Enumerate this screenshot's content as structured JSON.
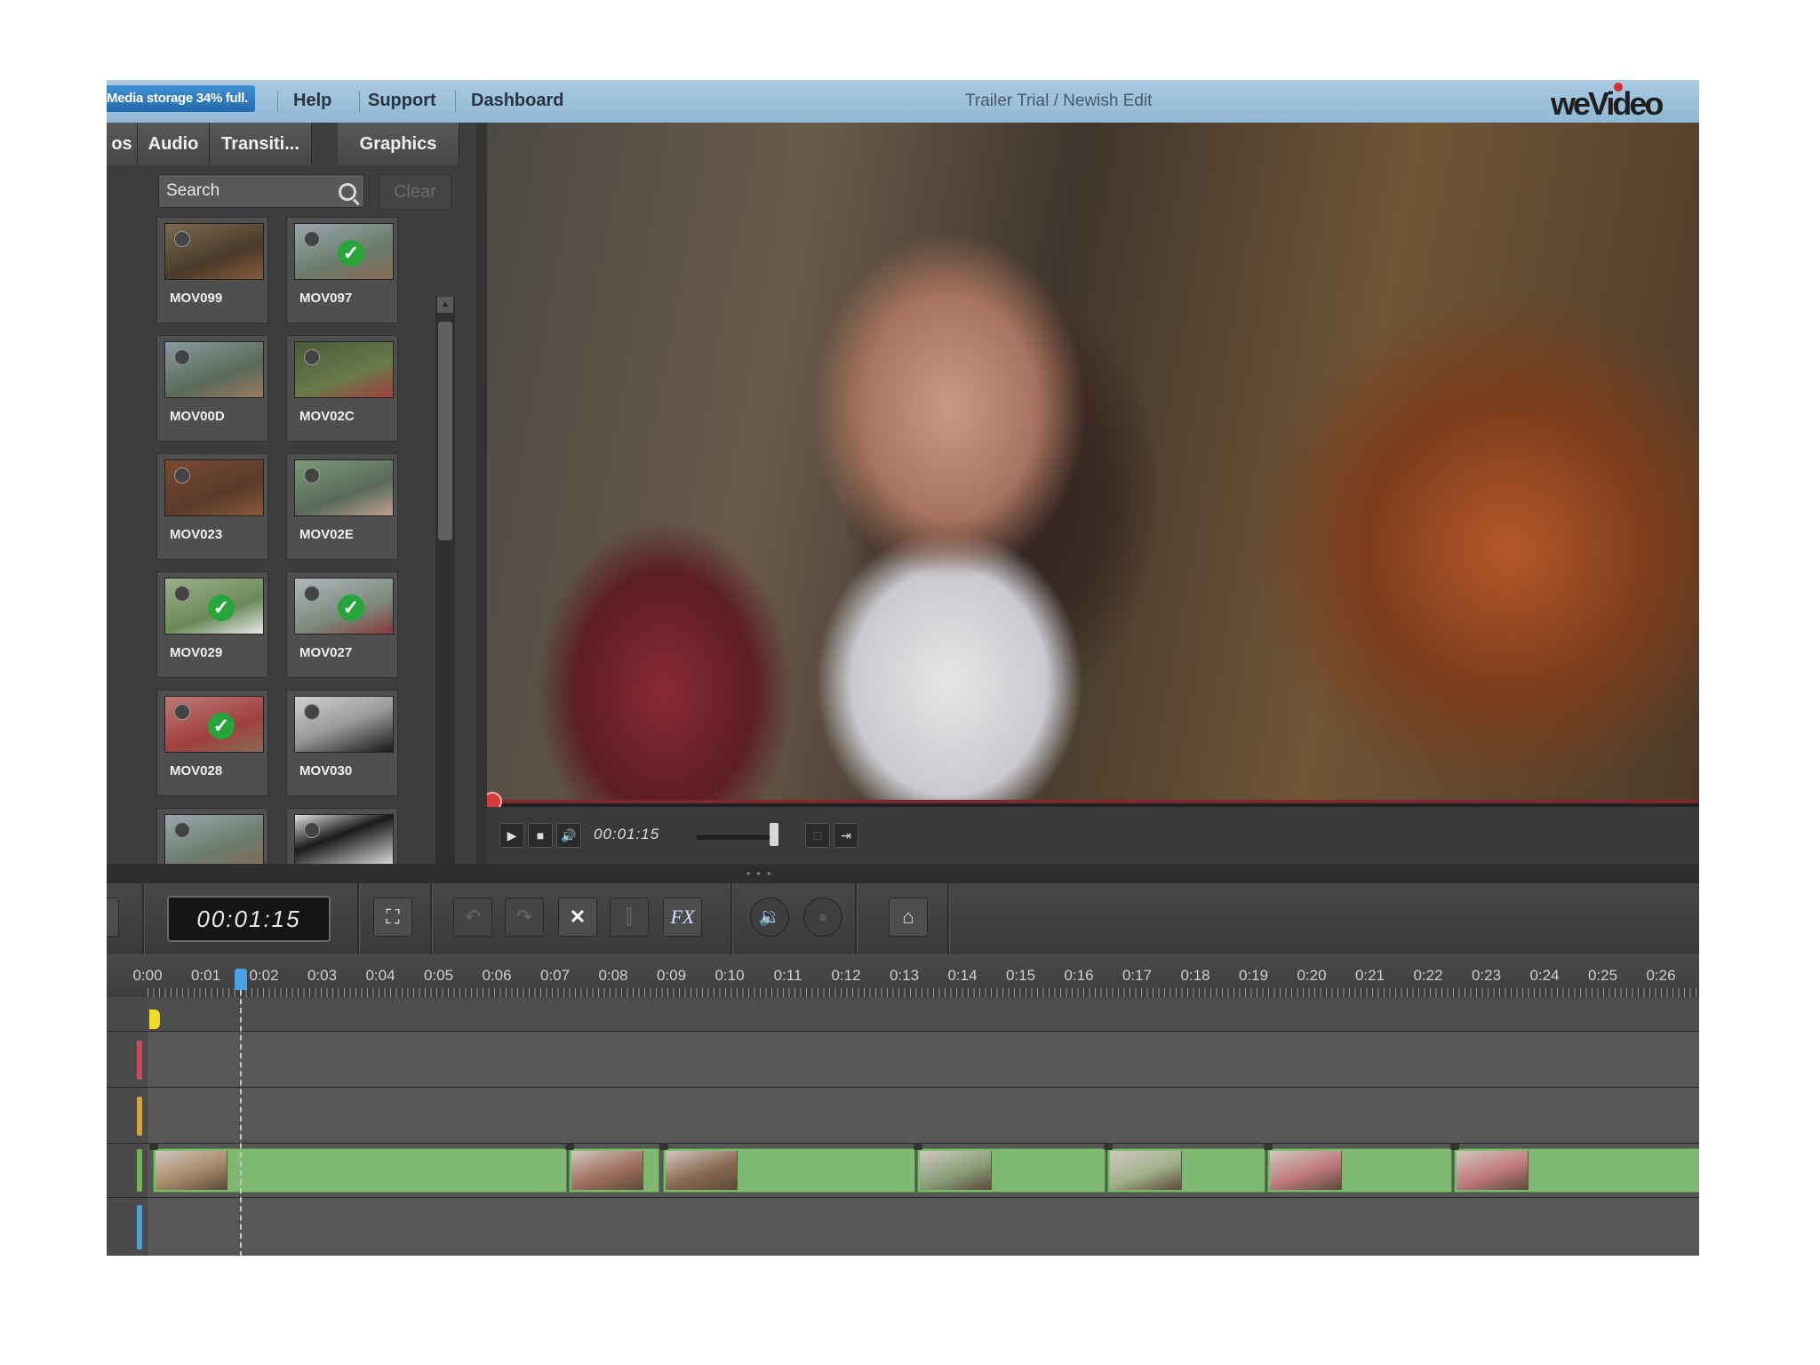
{
  "topbar": {
    "storage": "Media storage 34% full.",
    "links": [
      "Help",
      "Support",
      "Dashboard"
    ],
    "project_title": "Trailer Trial / Newish Edit",
    "logo": "weVideo"
  },
  "media_panel": {
    "tabs": [
      "os",
      "Audio",
      "Transiti...",
      "Graphics"
    ],
    "search_placeholder": "Search",
    "clear_label": "Clear",
    "items": [
      {
        "label": "MOV099",
        "checked": false
      },
      {
        "label": "MOV097",
        "checked": true
      },
      {
        "label": "MOV00D",
        "checked": false
      },
      {
        "label": "MOV02C",
        "checked": false
      },
      {
        "label": "MOV023",
        "checked": false
      },
      {
        "label": "MOV02E",
        "checked": false
      },
      {
        "label": "MOV029",
        "checked": true
      },
      {
        "label": "MOV027",
        "checked": true
      },
      {
        "label": "MOV028",
        "checked": true
      },
      {
        "label": "MOV030",
        "checked": false
      },
      {
        "label": "",
        "checked": false
      },
      {
        "label": "",
        "checked": false
      }
    ]
  },
  "player": {
    "time": "00:01:15",
    "play_icon": "play-icon",
    "stop_icon": "stop-icon",
    "volume_icon": "speaker-icon",
    "export_icon": "export-icon",
    "volume_level": 0.9
  },
  "toolbar": {
    "timecode": "00:01:15",
    "fx_label": "FX",
    "buttons": [
      "fullscreen-icon",
      "undo-icon",
      "redo-icon",
      "delete-icon",
      "split-icon",
      "fx-icon",
      "audio-icon",
      "camera-icon",
      "home-icon"
    ]
  },
  "timeline": {
    "ruler": [
      "0:00",
      "0:01",
      "0:02",
      "0:03",
      "0:04",
      "0:05",
      "0:06",
      "0:07",
      "0:08",
      "0:09",
      "0:10",
      "0:11",
      "0:12",
      "0:13",
      "0:14",
      "0:15",
      "0:16",
      "0:17",
      "0:18",
      "0:19",
      "0:20",
      "0:21",
      "0:22",
      "0:23",
      "0:24",
      "0:25",
      "0:26"
    ],
    "playhead": "0:01.5",
    "track_colors": [
      "#c94a5e",
      "#d6a43a",
      "#6fb35c",
      "#4aa3d6"
    ]
  }
}
